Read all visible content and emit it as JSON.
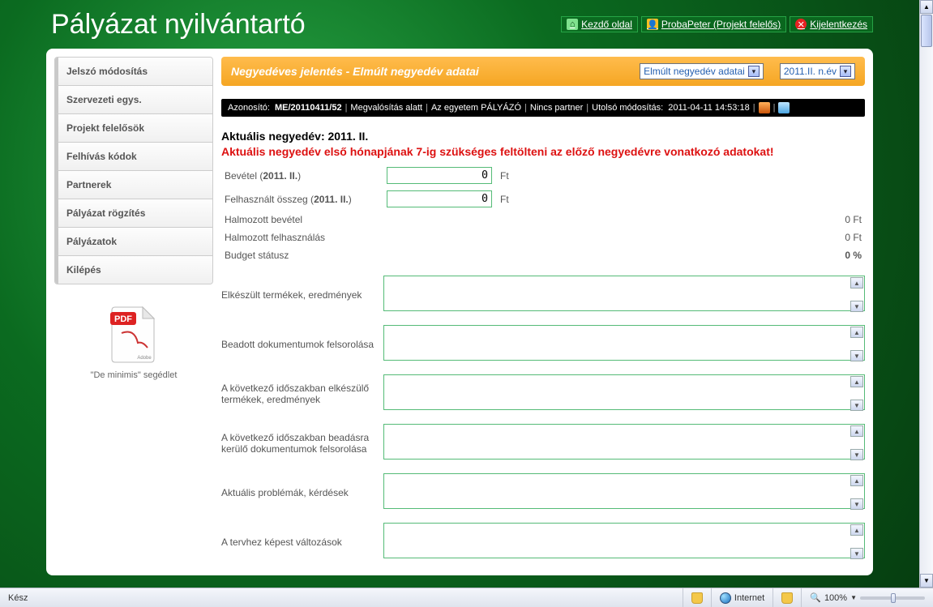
{
  "app_title": "Pályázat nyilvántartó",
  "top_links": {
    "home": "Kezdő oldal",
    "user": "ProbaPeter (Projekt felelős)",
    "logout": "Kijelentkezés"
  },
  "sidebar": {
    "items": [
      "Jelszó módosítás",
      "Szervezeti egys.",
      "Projekt felelősök",
      "Felhívás kódok",
      "Partnerek",
      "Pályázat rögzítés",
      "Pályázatok",
      "Kilépés"
    ],
    "pdf_caption": "\"De minimis\" segédlet",
    "pdf_badge": "PDF",
    "pdf_adobe": "Adobe"
  },
  "header": {
    "title": "Negyedéves jelentés - Elmúlt negyedév adatai",
    "select1": "Elmúlt negyedév adatai",
    "select2": "2011.II. n.év"
  },
  "infobar": {
    "prefix": "Azonosító:",
    "id": "ME/20110411/52",
    "status": "Megvalósítás alatt",
    "role": "Az egyetem PÁLYÁZÓ",
    "partner": "Nincs partner",
    "mod_prefix": "Utolsó módosítás:",
    "mod_time": "2011-04-11 14:53:18"
  },
  "main": {
    "period_label": "Aktuális negyedév: 2011. II.",
    "warning": "Aktuális negyedév első hónapjának 7-ig szükséges feltölteni az előző negyedévre vonatkozó adatokat!",
    "currency": "Ft",
    "bevetel_label_pre": "Bevétel (",
    "bevetel_label_b": "2011. II.",
    "bevetel_label_post": ")",
    "bevetel_value": "0",
    "felh_label_pre": "Felhasznált összeg (",
    "felh_label_b": "2011. II.",
    "felh_label_post": ")",
    "felh_value": "0",
    "sum1_label": "Halmozott bevétel",
    "sum1_value": "0 Ft",
    "sum2_label": "Halmozott felhasználás",
    "sum2_value": "0 Ft",
    "sum3_label": "Budget státusz",
    "sum3_value": "0 %",
    "ta": [
      {
        "label": "Elkészült termékek, eredmények",
        "value": ""
      },
      {
        "label": "Beadott dokumentumok felsorolása",
        "value": ""
      },
      {
        "label": "A következő időszakban elkészülő termékek, eredmények",
        "value": ""
      },
      {
        "label": "A következő időszakban beadásra kerülő dokumentumok felsorolása",
        "value": ""
      },
      {
        "label": "Aktuális problémák, kérdések",
        "value": ""
      },
      {
        "label": "A tervhez képest változások",
        "value": ""
      }
    ]
  },
  "statusbar": {
    "left": "Kész",
    "zone": "Internet",
    "zoom": "100%"
  }
}
